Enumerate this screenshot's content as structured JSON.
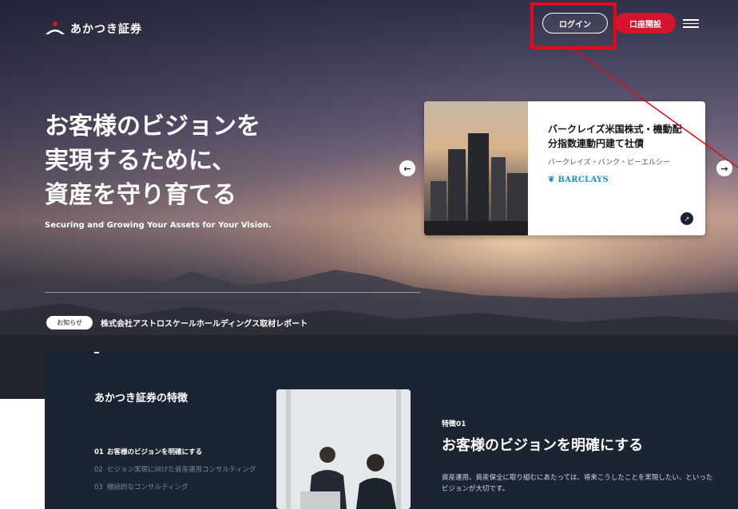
{
  "header": {
    "logo_text": "あかつき証券",
    "login_label": "ログイン",
    "open_account_label": "口座開設"
  },
  "hero": {
    "title_lines": [
      "お客様のビジョンを",
      "実現するために、",
      "資産を守り育てる"
    ],
    "subtitle": "Securing and Growing Your Assets for Your Vision."
  },
  "carousel": {
    "prev_arrow": "←",
    "next_arrow": "→",
    "card": {
      "title_lines": [
        "バークレイズ米国株式・機動配",
        "分指数連動円建て社債"
      ],
      "issuer": "バークレイズ・バンク・ピーエルシー",
      "brand": "BARCLAYS",
      "link_arrow": "↗"
    }
  },
  "news": {
    "badge": "お知らせ",
    "text": "株式会社アストロスケールホールディングス取材レポート"
  },
  "features": {
    "title": "あかつき証券の特徴",
    "items": [
      {
        "num": "01",
        "label": "お客様のビジョンを明確にする"
      },
      {
        "num": "02",
        "label": "ビジョン実現に向けた資産運用コンサルティング"
      },
      {
        "num": "03",
        "label": "継続的なコンサルティング"
      }
    ],
    "active_label": "特徴01",
    "active_heading": "お客様のビジョンを明確にする",
    "active_description": "資産運用、資産保全に取り組むにあたっては、将来こうしたことを実現したい、といったビジョンが大切です。"
  },
  "colors": {
    "accent_red": "#d7132e",
    "highlight_red": "#e5081a",
    "dark_navy": "#1b2431",
    "barclays_blue": "#1a8fd3"
  }
}
